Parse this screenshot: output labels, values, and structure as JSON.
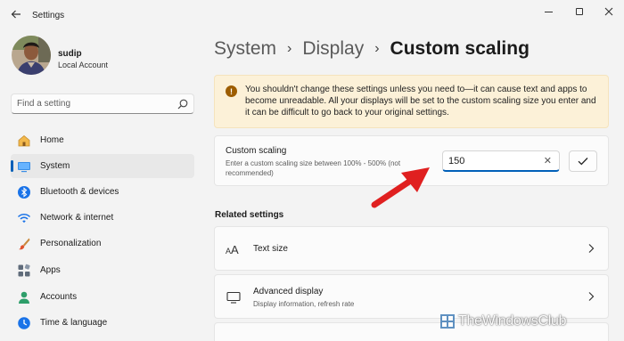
{
  "window": {
    "title": "Settings",
    "back_icon": "back-arrow-icon"
  },
  "user": {
    "name": "sudip",
    "account_type": "Local Account"
  },
  "search": {
    "placeholder": "Find a setting"
  },
  "sidebar": {
    "items": [
      {
        "label": "Home",
        "icon": "home-icon",
        "active": false
      },
      {
        "label": "System",
        "icon": "system-icon",
        "active": true
      },
      {
        "label": "Bluetooth & devices",
        "icon": "bluetooth-icon",
        "active": false
      },
      {
        "label": "Network & internet",
        "icon": "network-icon",
        "active": false
      },
      {
        "label": "Personalization",
        "icon": "brush-icon",
        "active": false
      },
      {
        "label": "Apps",
        "icon": "apps-icon",
        "active": false
      },
      {
        "label": "Accounts",
        "icon": "accounts-icon",
        "active": false
      },
      {
        "label": "Time & language",
        "icon": "time-language-icon",
        "active": false
      }
    ]
  },
  "breadcrumb": {
    "items": [
      "System",
      "Display"
    ],
    "current": "Custom scaling"
  },
  "warning": {
    "text": "You shouldn't change these settings unless you need to—it can cause text and apps to become unreadable. All your displays will be set to the custom scaling size you enter and it can be difficult to go back to your original settings."
  },
  "custom_scaling": {
    "title": "Custom scaling",
    "description": "Enter a custom scaling size between 100% - 500% (not recommended)",
    "value": "150"
  },
  "related": {
    "heading": "Related settings",
    "items": [
      {
        "title": "Text size",
        "subtitle": "",
        "icon": "text-size-icon"
      },
      {
        "title": "Advanced display",
        "subtitle": "Display information, refresh rate",
        "icon": "monitor-icon"
      }
    ]
  },
  "watermark": {
    "text": "TheWindowsClub"
  },
  "colors": {
    "accent": "#005fb8",
    "warning_bg": "#fcf1d8",
    "warning_icon": "#9d5d00",
    "annotation_arrow": "#e02020"
  }
}
